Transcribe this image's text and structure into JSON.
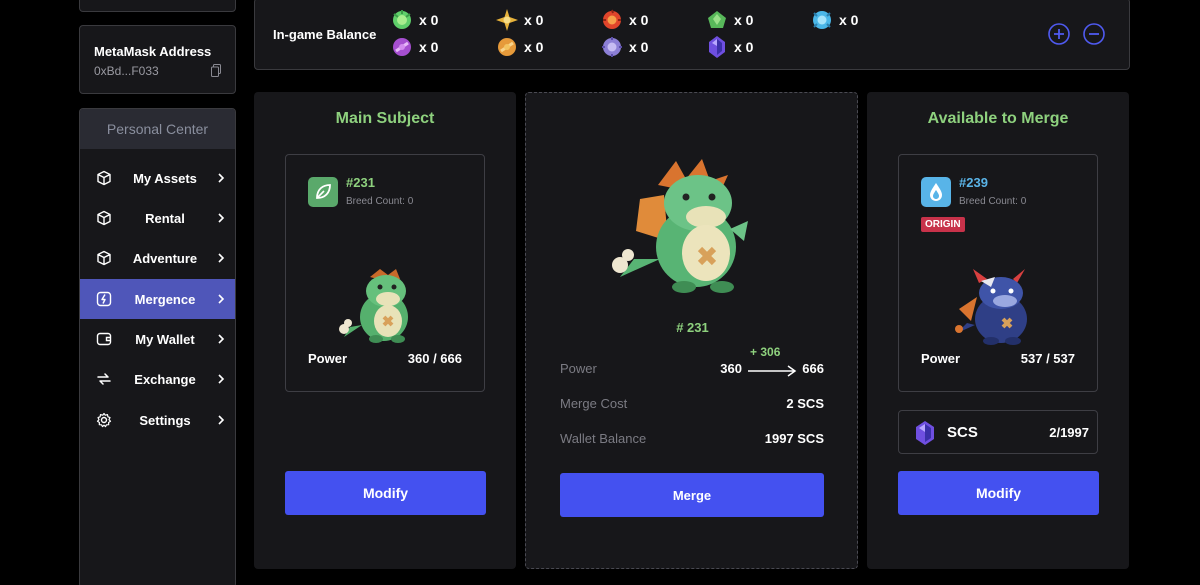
{
  "sidebar": {
    "metamask_title": "MetaMask Address",
    "metamask_address": "0xBd...F033",
    "header": "Personal Center",
    "items": [
      {
        "label": "My Assets",
        "icon": "cube-icon",
        "active": false
      },
      {
        "label": "Rental",
        "icon": "cube-icon",
        "active": false
      },
      {
        "label": "Adventure",
        "icon": "cube-icon",
        "active": false
      },
      {
        "label": "Mergence",
        "icon": "merge-icon",
        "active": true
      },
      {
        "label": "My Wallet",
        "icon": "wallet-icon",
        "active": false
      },
      {
        "label": "Exchange",
        "icon": "exchange-icon",
        "active": false
      },
      {
        "label": "Settings",
        "icon": "gear-icon",
        "active": false
      }
    ]
  },
  "balance": {
    "title": "In-game Balance",
    "gems": [
      {
        "name": "green-gem-icon",
        "count": "x 0",
        "color": "#5fcf6a"
      },
      {
        "name": "gold-star-gem-icon",
        "count": "x 0",
        "color": "#e6b13a"
      },
      {
        "name": "red-gem-icon",
        "count": "x 0",
        "color": "#e0452b"
      },
      {
        "name": "green-leaf-gem-icon",
        "count": "x 0",
        "color": "#58b85a"
      },
      {
        "name": "blue-gem-icon",
        "count": "x 0",
        "color": "#4ab7e8"
      },
      {
        "name": "purple-gem-icon",
        "count": "x 0",
        "color": "#a64fd0"
      },
      {
        "name": "orange-gem-icon",
        "count": "x 0",
        "color": "#e69a3a"
      },
      {
        "name": "violet-gem-icon",
        "count": "x 0",
        "color": "#8c7fd6"
      },
      {
        "name": "crystal-gem-icon",
        "count": "x 0",
        "color": "#6f4fe0"
      }
    ]
  },
  "main_subject": {
    "title": "Main Subject",
    "id": "#231",
    "breed": "Breed Count: 0",
    "power_label": "Power",
    "power_value": "360 / 666",
    "button": "Modify"
  },
  "merge": {
    "id": "# 231",
    "power_label": "Power",
    "power_from": "360",
    "power_delta": "+ 306",
    "power_to": "666",
    "cost_label": "Merge Cost",
    "cost_value": "2 SCS",
    "wallet_label": "Wallet Balance",
    "wallet_value": "1997 SCS",
    "button": "Merge"
  },
  "available": {
    "title": "Available to Merge",
    "id": "#239",
    "breed": "Breed Count: 0",
    "tag": "ORIGIN",
    "power_label": "Power",
    "power_value": "537 / 537",
    "scs_label": "SCS",
    "scs_value": "2/1997",
    "button": "Modify"
  },
  "colors": {
    "accent": "#4451f0",
    "active_nav": "#4f56b9",
    "green_title": "#8ed17e",
    "id_green": "#8ed17e",
    "id_blue": "#5ab4e8",
    "origin_tag": "#c8324a"
  }
}
